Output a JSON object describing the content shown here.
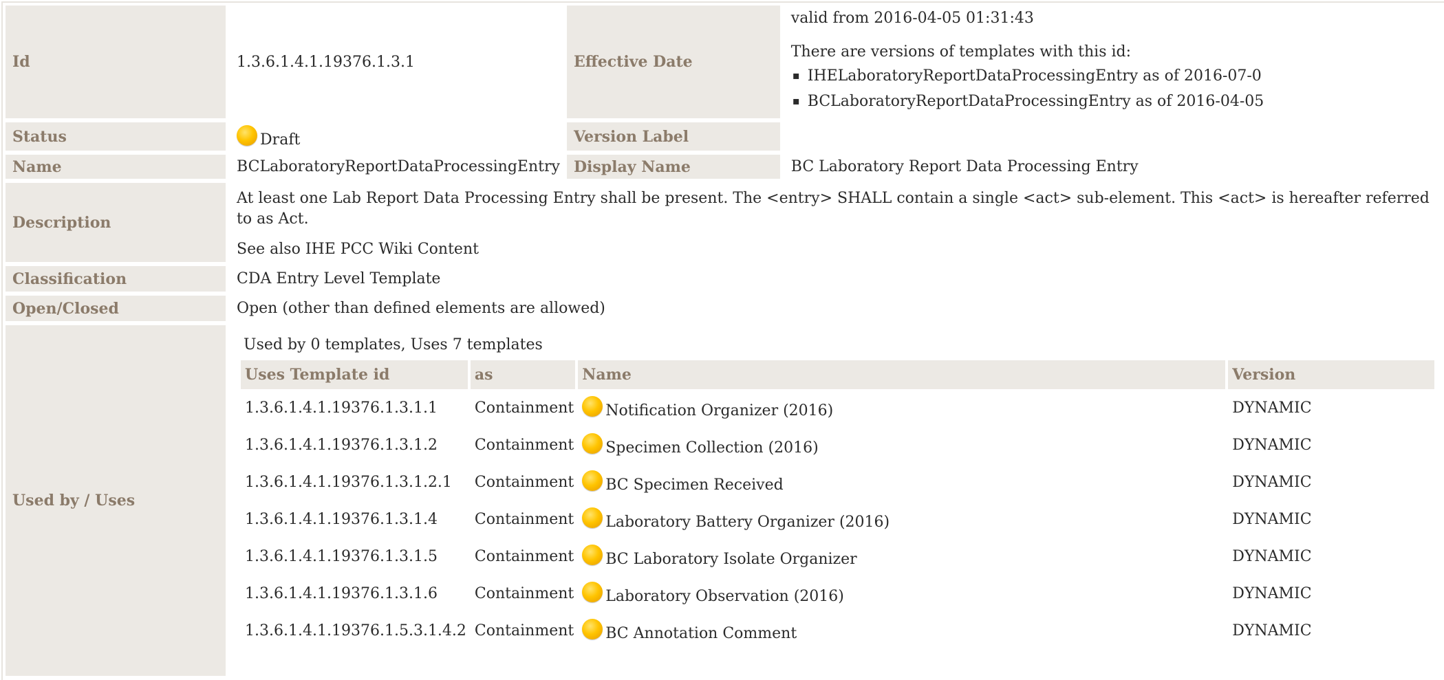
{
  "labels": {
    "id": "Id",
    "effective_date": "Effective Date",
    "status": "Status",
    "version_label": "Version Label",
    "name": "Name",
    "display_name": "Display Name",
    "description": "Description",
    "classification": "Classification",
    "open_closed": "Open/Closed",
    "used_by_uses": "Used by / Uses"
  },
  "values": {
    "id": "1.3.6.1.4.1.19376.1.3.1",
    "effective_date": "valid from 2016-04-05 01:31:43",
    "versions_intro": "There are versions of templates with this id:",
    "versions": [
      "IHELaboratoryReportDataProcessingEntry as of 2016-07-0",
      "BCLaboratoryReportDataProcessingEntry as of 2016-04-05"
    ],
    "status": "Draft",
    "version_label": "",
    "name": "BCLaboratoryReportDataProcessingEntry",
    "display_name": "BC Laboratory Report Data Processing Entry",
    "description_1": "At least one Lab Report Data Processing Entry shall be present. The <entry> SHALL contain a single <act> sub-element. This <act> is hereafter referred to as Act.",
    "description_2": "See also IHE PCC Wiki Content",
    "classification": "CDA Entry Level Template",
    "open_closed": "Open (other than defined elements are allowed)"
  },
  "uses": {
    "summary": "Used by 0 templates, Uses 7 templates",
    "headers": {
      "id": "Uses Template id",
      "as": "as",
      "name": "Name",
      "version": "Version"
    },
    "rows": [
      {
        "id": "1.3.6.1.4.1.19376.1.3.1.1",
        "as": "Containment",
        "name": "Notification Organizer (2016)",
        "version": "DYNAMIC"
      },
      {
        "id": "1.3.6.1.4.1.19376.1.3.1.2",
        "as": "Containment",
        "name": "Specimen Collection (2016)",
        "version": "DYNAMIC"
      },
      {
        "id": "1.3.6.1.4.1.19376.1.3.1.2.1",
        "as": "Containment",
        "name": "BC Specimen Received",
        "version": "DYNAMIC"
      },
      {
        "id": "1.3.6.1.4.1.19376.1.3.1.4",
        "as": "Containment",
        "name": "Laboratory Battery Organizer (2016)",
        "version": "DYNAMIC"
      },
      {
        "id": "1.3.6.1.4.1.19376.1.3.1.5",
        "as": "Containment",
        "name": "BC Laboratory Isolate Organizer",
        "version": "DYNAMIC"
      },
      {
        "id": "1.3.6.1.4.1.19376.1.3.1.6",
        "as": "Containment",
        "name": "Laboratory Observation (2016)",
        "version": "DYNAMIC"
      },
      {
        "id": "1.3.6.1.4.1.19376.1.5.3.1.4.2",
        "as": "Containment",
        "name": "BC Annotation Comment",
        "version": "DYNAMIC"
      }
    ]
  },
  "icons": {
    "status": "status-draft-icon"
  },
  "colors": {
    "label_bg": "#ece9e4",
    "label_text": "#8b7b6a",
    "status_draft": "#ffc400"
  }
}
